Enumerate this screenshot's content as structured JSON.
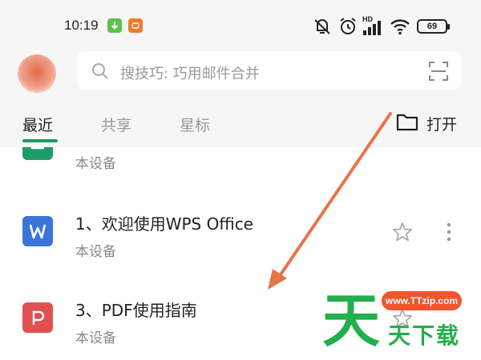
{
  "status_bar": {
    "time": "10:19",
    "battery": "69",
    "network_label": "HD"
  },
  "header": {
    "search_placeholder": "搜技巧: 巧用邮件合并"
  },
  "tabs": [
    {
      "label": "最近",
      "active": true
    },
    {
      "label": "共享",
      "active": false
    },
    {
      "label": "星标",
      "active": false
    }
  ],
  "open_button": {
    "label": "打开"
  },
  "files": [
    {
      "title": "",
      "location": "本设备",
      "icon": "green-doc-icon",
      "color": "#1f9b6a"
    },
    {
      "title": "1、欢迎使用WPS Office",
      "location": "本设备",
      "icon": "word-icon",
      "color": "#3b74d8"
    },
    {
      "title": "3、PDF使用指南",
      "location": "本设备",
      "icon": "pdf-icon",
      "color": "#e0504f"
    }
  ],
  "watermark": {
    "url": "www.TTzip.com",
    "big_char": "天",
    "text": "天下载"
  },
  "colors": {
    "accent": "#1d9b5e",
    "arrow": "#e8744a"
  }
}
